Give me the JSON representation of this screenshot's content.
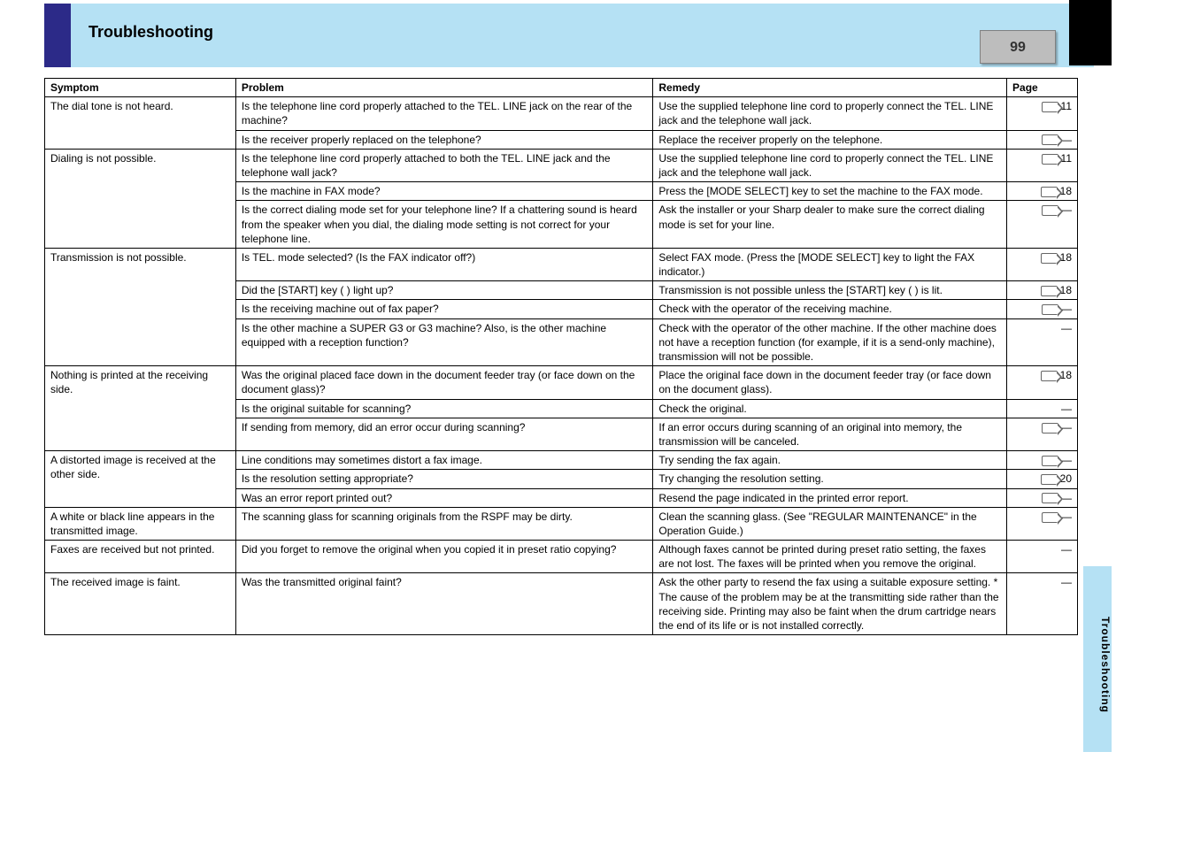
{
  "page_number_badge": "99",
  "header_title": "Troubleshooting",
  "side_tab_text": "Troubleshooting",
  "columns": {
    "symptom": "Symptom",
    "problem": "Problem",
    "remedy": "Remedy",
    "page": "Page"
  },
  "rows": [
    {
      "symptom": "The dial tone is not heard.",
      "problem": "Is the telephone line cord properly attached to the TEL. LINE jack on the rear of the machine?",
      "remedy": "Use the supplied telephone line cord to properly connect the TEL. LINE jack and the telephone wall jack.",
      "page": "11",
      "arrow": true
    },
    {
      "symptom": "",
      "problem": "Is the receiver properly replaced on the telephone?",
      "remedy": "Replace the receiver properly on the telephone.",
      "page": "—",
      "arrow": true
    },
    {
      "symptom": "Dialing is not possible.",
      "problem": "Is the telephone line cord properly attached to both the TEL. LINE jack and the telephone wall jack?",
      "remedy": "Use the supplied telephone line cord to properly connect the TEL. LINE jack and the telephone wall jack.",
      "page": "11",
      "arrow": true
    },
    {
      "symptom": "",
      "problem": "Is the machine in FAX mode?",
      "remedy": "Press the [MODE SELECT] key to set the machine to the FAX mode.",
      "page": "18",
      "arrow": true
    },
    {
      "symptom": "",
      "problem": "Is the correct dialing mode set for your telephone line?\nIf a chattering sound is heard from the speaker when you dial, the dialing mode setting is not correct for your telephone line.",
      "remedy": "Ask the installer or your Sharp dealer to make sure the correct dialing mode is set for your line.",
      "page": "—",
      "arrow": true
    },
    {
      "symptom": "Transmission is not possible.",
      "problem": "Is TEL. mode selected? (Is the FAX indicator off?)",
      "remedy": "Select FAX mode. (Press the [MODE SELECT] key to light the FAX indicator.)",
      "page": "18",
      "arrow": true
    },
    {
      "symptom": "",
      "problem": "Did the [START] key (           ) light up?",
      "remedy": "Transmission is not possible unless the [START] key (           ) is lit.",
      "page": "18",
      "arrow": true
    },
    {
      "symptom": "",
      "problem": "Is the receiving machine out of fax paper?",
      "remedy": "Check with the operator of the receiving machine.",
      "page": "—",
      "arrow": true
    },
    {
      "symptom": "",
      "problem": "Is the other machine a SUPER G3 or G3 machine?\nAlso, is the other machine equipped with a reception function?",
      "remedy": "Check with the operator of the other machine. If the other machine does not have a reception function (for example, if it is a send-only machine), transmission will not be possible.",
      "page": "—",
      "arrow": false
    },
    {
      "symptom": "Nothing is printed at the receiving side.",
      "problem": "Was the original placed face down in the document feeder tray (or face down on the document glass)?",
      "remedy": "Place the original face down in the document feeder tray (or face down on the document glass).",
      "page": "18",
      "arrow": true
    },
    {
      "symptom": "",
      "problem": "Is the original suitable for scanning?",
      "remedy": "Check the original.",
      "page": "—",
      "arrow": false
    },
    {
      "symptom": "",
      "problem": "If sending from memory, did an error occur during scanning?",
      "remedy": "If an error occurs during scanning of an original into memory, the transmission will be canceled.",
      "page": "—",
      "arrow": true
    },
    {
      "symptom": "A distorted image is received at the other side.",
      "problem": "Line conditions may sometimes distort a fax image.",
      "remedy": "Try sending the fax again.",
      "page": "—",
      "arrow": true
    },
    {
      "symptom": "",
      "problem": "Is the resolution setting appropriate?",
      "remedy": "Try changing the resolution setting.",
      "page": "20",
      "arrow": true
    },
    {
      "symptom": "",
      "problem": "Was an error report printed out?",
      "remedy": "Resend the page indicated in the printed error report.",
      "page": "—",
      "arrow": true
    },
    {
      "symptom": "A white or black line appears in the transmitted image.",
      "problem": "The scanning glass for scanning originals from the RSPF may be dirty.",
      "remedy": "Clean the scanning glass. (See \"REGULAR MAINTENANCE\" in the Operation Guide.)",
      "page": "—",
      "arrow": true
    },
    {
      "symptom": "Faxes are received but not printed.",
      "problem": "Did you forget to remove the original when you copied it in preset ratio copying?",
      "remedy": "Although faxes cannot be printed during preset ratio setting, the faxes are not lost. The faxes will be printed when you remove the original.",
      "page": "—",
      "arrow": false
    },
    {
      "symptom": "The received image is faint.",
      "problem": "Was the transmitted original faint?",
      "remedy": "Ask the other party to resend the fax using a suitable exposure setting.\n* The cause of the problem may be at the transmitting side rather than the receiving side. Printing may also be faint when the drum cartridge nears the end of its life or is not installed correctly.",
      "page": "—",
      "arrow": false
    }
  ]
}
